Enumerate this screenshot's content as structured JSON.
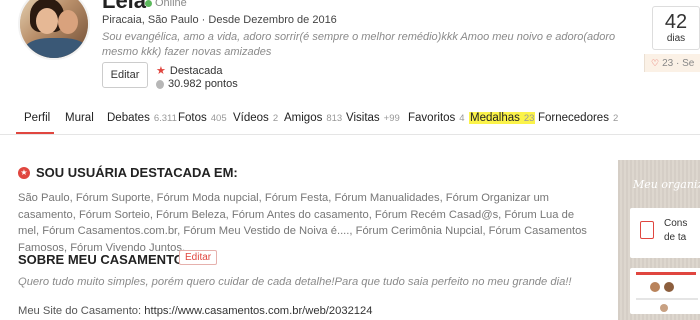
{
  "profile": {
    "name": "Leia",
    "status": "Online",
    "location": "Piracaia, São Paulo · Desde Dezembro de 2016",
    "bio": "Sou evangélica, amo a vida, adoro sorrir(é sempre o melhor remédio)kkk Amoo meu noivo e adoro(adoro mesmo kkk) fazer novas amizades",
    "edit_label": "Editar",
    "badge": "Destacada",
    "points": "30.982 pontos"
  },
  "countdown": {
    "number": "42",
    "unit": "dias",
    "date": "23 · Se"
  },
  "tabs": [
    {
      "label": "Perfil",
      "count": ""
    },
    {
      "label": "Mural",
      "count": ""
    },
    {
      "label": "Debates",
      "count": "6.311"
    },
    {
      "label": "Fotos",
      "count": "405"
    },
    {
      "label": "Vídeos",
      "count": "2"
    },
    {
      "label": "Amigos",
      "count": "813"
    },
    {
      "label": "Visitas",
      "count": "+99"
    },
    {
      "label": "Favoritos",
      "count": "4"
    },
    {
      "label": "Medalhas",
      "count": "23"
    },
    {
      "label": "Fornecedores",
      "count": "2"
    }
  ],
  "featured": {
    "heading": "SOU USUÁRIA DESTACADA EM:",
    "forums": "São Paulo, Fórum Suporte, Fórum Moda nupcial, Fórum Festa, Fórum Manualidades, Fórum Organizar um casamento, Fórum Sorteio, Fórum Beleza, Fórum Antes do casamento, Fórum Recém Casad@s, Fórum Lua de mel, Fórum Casamentos.com.br, Fórum Meu Vestido de Noiva é...., Fórum Cerimônia Nupcial, Fórum Casamentos Famosos, Fórum Vivendo Juntos,"
  },
  "wedding": {
    "heading": "SOBRE MEU CASAMENTO",
    "edit_label": "Editar",
    "quote": "Quero tudo muito simples, porém quero cuidar de cada detalhe!Para que tudo saia perfeito no meu grande dia!!",
    "site_label": "Meu Site do Casamento:",
    "site_url": "https://www.casamentos.com.br/web/2032124"
  },
  "promo": {
    "title": "Meu organiz",
    "line1": "Cons",
    "line2": "de ta"
  },
  "colors": {
    "accent": "#e0463f",
    "highlight": "#fbf34a",
    "online": "#5cb85c"
  }
}
